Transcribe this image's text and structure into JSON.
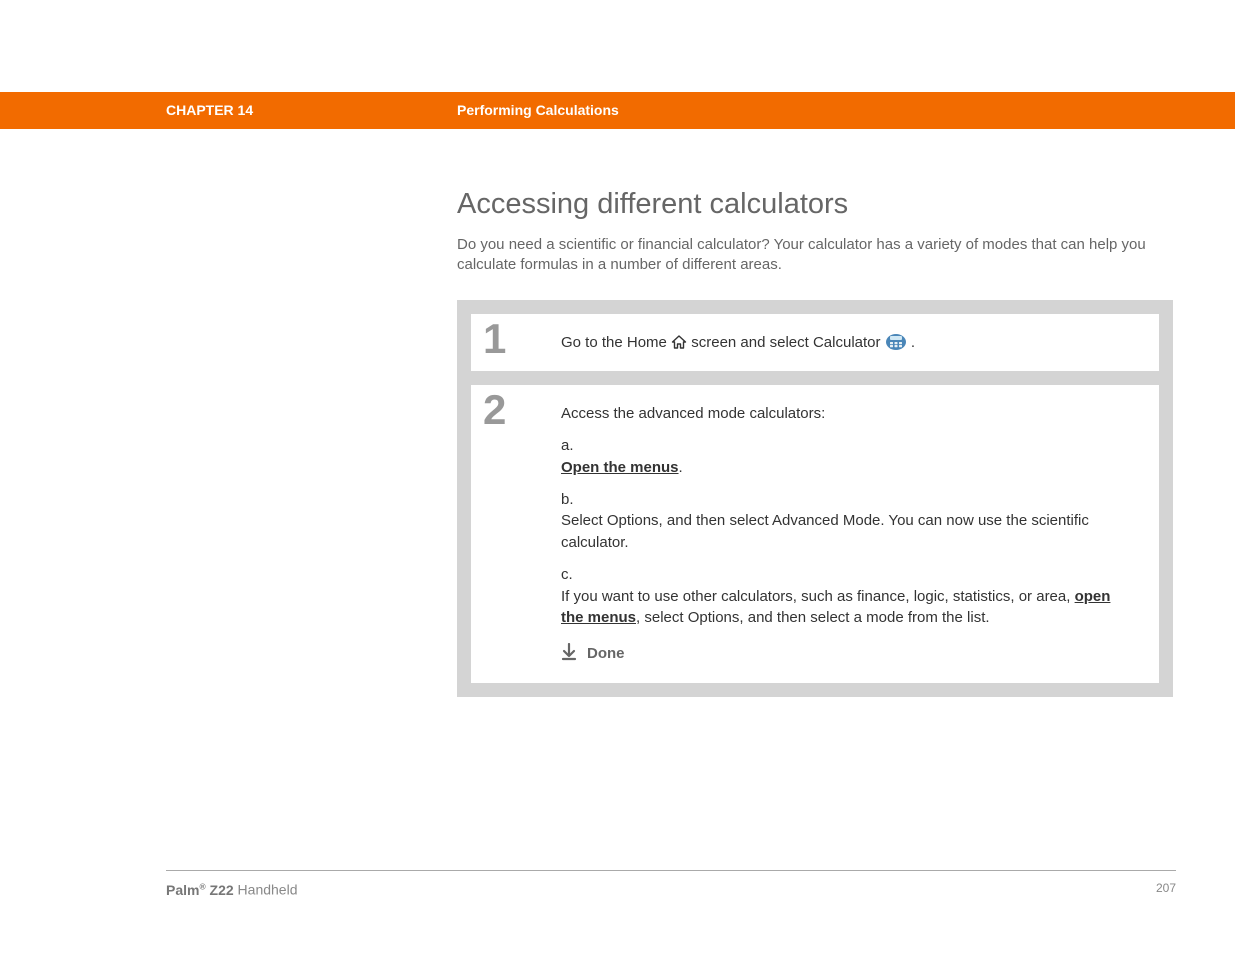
{
  "header": {
    "chapter": "CHAPTER 14",
    "title": "Performing Calculations"
  },
  "main": {
    "heading": "Accessing different calculators",
    "intro": "Do you need a scientific or financial calculator? Your calculator has a variety of modes that can help you calculate formulas in a number of different areas."
  },
  "steps": {
    "1": {
      "num": "1",
      "text_a": "Go to the Home ",
      "text_b": " screen and select Calculator ",
      "text_c": "."
    },
    "2": {
      "num": "2",
      "lead": "Access the advanced mode calculators:",
      "a_marker": "a.",
      "a_link": "Open the menus",
      "a_tail": ".",
      "b_marker": "b.",
      "b_text": "Select Options, and then select Advanced Mode. You can now use the scientific calculator.",
      "c_marker": "c.",
      "c_pre": "If you want to use other calculators, such as finance, logic, statistics, or area, ",
      "c_link": "open the menus",
      "c_post": ", select Options, and then select a mode from the list.",
      "done": "Done"
    }
  },
  "icons": {
    "home": "home-icon",
    "calculator": "calculator-icon",
    "downArrow": "down-arrow-icon"
  },
  "footer": {
    "brand_a": "Palm",
    "brand_reg": "®",
    "brand_b": " Z22",
    "brand_c": " Handheld",
    "page_no": "207"
  }
}
